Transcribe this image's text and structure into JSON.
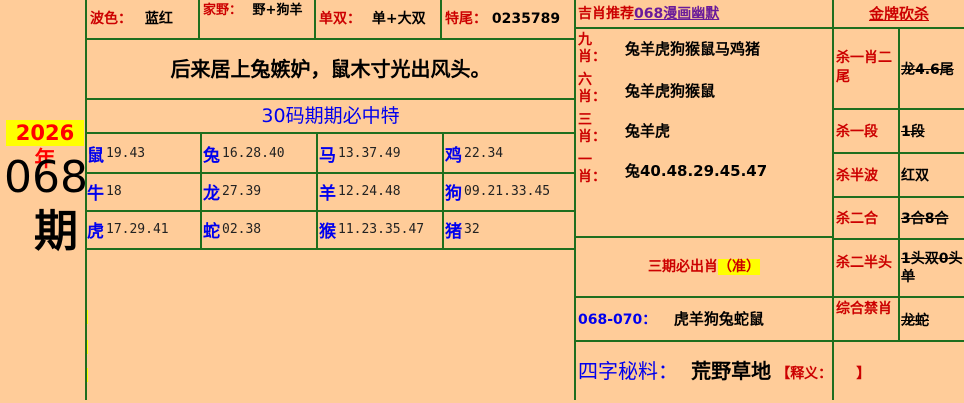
{
  "issue": {
    "year": "2026年",
    "number": "068",
    "suffix": "期"
  },
  "top_info": {
    "wave_label": "波色：",
    "wave_value": "蓝红",
    "domestic_label": "家野：",
    "domestic_value": "野+狗羊",
    "odd_even_label": "单双：",
    "odd_even_value": "单+大双",
    "tail_label": "特尾：",
    "tail_value": "0235789"
  },
  "poem": "后来居上兔嫉妒，鼠木寸光出风头。",
  "table_title": "30码期期必中特",
  "zodiac_rows": [
    [
      {
        "animal": "鼠",
        "nums": "19.43"
      },
      {
        "animal": "兔",
        "nums": "16.28.40"
      },
      {
        "animal": "马",
        "nums": "13.37.49"
      },
      {
        "animal": "鸡",
        "nums": "22.34"
      }
    ],
    [
      {
        "animal": "牛",
        "nums": "18"
      },
      {
        "animal": "龙",
        "nums": "27.39"
      },
      {
        "animal": "羊",
        "nums": "12.24.48"
      },
      {
        "animal": "狗",
        "nums": "09.21.33.45"
      }
    ],
    [
      {
        "animal": "虎",
        "nums": "17.29.41"
      },
      {
        "animal": "蛇",
        "nums": "02.38"
      },
      {
        "animal": "猴",
        "nums": "11.23.35.47"
      },
      {
        "animal": "猪",
        "nums": "32"
      }
    ]
  ],
  "recommend": {
    "header_prefix": "吉肖推荐",
    "header_link": "068漫画幽默",
    "rows": [
      {
        "label": "九肖：",
        "value": "兔羊虎狗猴鼠马鸡猪"
      },
      {
        "label": "六肖：",
        "value": "兔羊虎狗猴鼠"
      },
      {
        "label": "三肖：",
        "value": "兔羊虎"
      },
      {
        "label": "一肖：",
        "value": "兔40.48.29.45.47"
      }
    ]
  },
  "three_issue": {
    "text": "三期必出肖",
    "tag": "（准）"
  },
  "range_pick": {
    "range": "068-070：",
    "value": "虎羊狗兔蛇鼠"
  },
  "four_char": {
    "label": "四字秘料：",
    "value": "荒野草地",
    "note_open": "【",
    "note_label": "释义：",
    "note_close": "】"
  },
  "kill": {
    "header": "金牌砍杀",
    "rows": [
      {
        "label": "杀一肖二尾",
        "value": "龙4.6尾"
      },
      {
        "label": "杀一段",
        "value": "1段"
      },
      {
        "label": "杀半波",
        "value": "红双"
      },
      {
        "label": "杀二合",
        "value": "3合8合"
      },
      {
        "label": "杀二半头",
        "value": "1头双0头单"
      },
      {
        "label": "综合禁肖",
        "value": "龙蛇"
      }
    ]
  },
  "colors": {
    "background": "#FFCC99",
    "border": "#1e6e1e",
    "red": "#cc0000",
    "blue": "#0000ee",
    "highlight": "#ffff00"
  }
}
